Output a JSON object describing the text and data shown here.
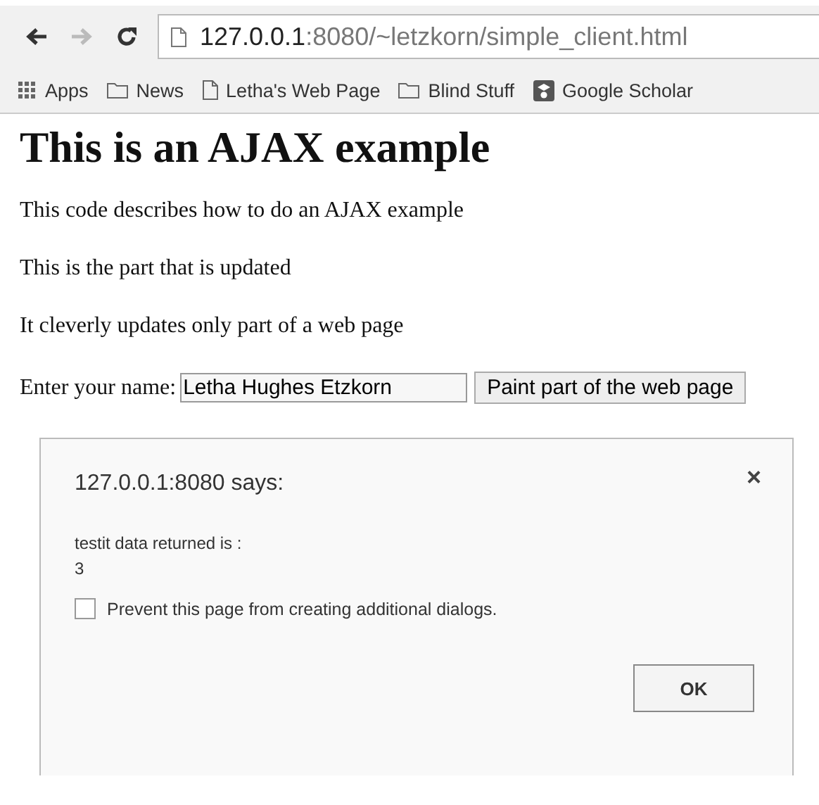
{
  "toolbar": {
    "nav_buttons": [
      {
        "kind": "back",
        "disabled": false
      },
      {
        "kind": "forward",
        "disabled": true
      },
      {
        "kind": "reload",
        "disabled": false
      }
    ],
    "address": {
      "host": "127.0.0.1",
      "path": ":8080/~letzkorn/simple_client.html"
    }
  },
  "bookmarks": [
    {
      "kind": "apps",
      "label": "Apps"
    },
    {
      "kind": "folder",
      "label": "News"
    },
    {
      "kind": "page",
      "label": "Letha's Web Page"
    },
    {
      "kind": "folder",
      "label": "Blind Stuff"
    },
    {
      "kind": "scholar",
      "label": "Google Scholar"
    }
  ],
  "page": {
    "heading": "This is an AJAX example",
    "paragraphs": [
      "This code describes how to do an AJAX example",
      "This is the part that is updated",
      "It cleverly updates only part of a web page"
    ],
    "name_label": "Enter your name:",
    "name_value": "Letha Hughes Etzkorn",
    "submit_button": "Paint part of the web page"
  },
  "dialog": {
    "title": "127.0.0.1:8080 says:",
    "close": "×",
    "message_lines": [
      "testit data returned is :",
      "3"
    ],
    "prevent_checkbox": {
      "label": "Prevent this page from creating additional dialogs.",
      "checked": false
    },
    "ok_button": "OK"
  }
}
